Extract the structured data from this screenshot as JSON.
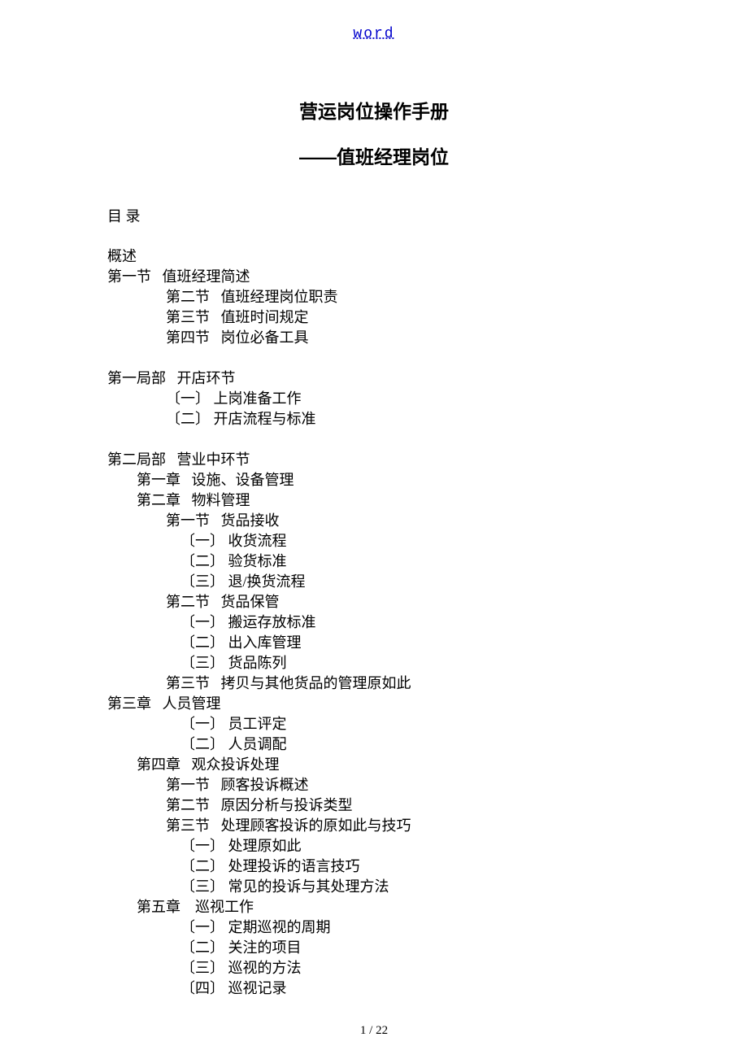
{
  "header_link": "word",
  "title": "营运岗位操作手册",
  "subtitle": "——值班经理岗位",
  "toc_heading": "目      录",
  "page_number": "1 / 22",
  "toc": [
    {
      "text": "概述",
      "indent": 0
    },
    {
      "text": "第一节   值班经理简述",
      "indent": 0
    },
    {
      "text": "第二节   值班经理岗位职责",
      "indent": 2
    },
    {
      "text": "第三节   值班时间规定",
      "indent": 2
    },
    {
      "text": "第四节   岗位必备工具",
      "indent": 2
    },
    {
      "spacer": true
    },
    {
      "text": "第一局部   开店环节",
      "indent": 0
    },
    {
      "text": "〔一〕 上岗准备工作",
      "indent": 2
    },
    {
      "text": "〔二〕 开店流程与标准",
      "indent": 2
    },
    {
      "spacer": true
    },
    {
      "text": "第二局部   营业中环节",
      "indent": 0
    },
    {
      "text": "第一章   设施、设备管理",
      "indent": 1
    },
    {
      "text": "第二章   物料管理",
      "indent": 1
    },
    {
      "text": "第一节   货品接收",
      "indent": 2
    },
    {
      "text": "〔一〕 收货流程",
      "indent": 3
    },
    {
      "text": "〔二〕 验货标准",
      "indent": 3
    },
    {
      "text": "〔三〕 退/换货流程",
      "indent": 3
    },
    {
      "text": "第二节   货品保管",
      "indent": 2
    },
    {
      "text": "〔一〕 搬运存放标准",
      "indent": 3
    },
    {
      "text": "〔二〕 出入库管理",
      "indent": 3
    },
    {
      "text": "〔三〕 货品陈列",
      "indent": 3
    },
    {
      "text": "第三节   拷贝与其他货品的管理原如此",
      "indent": 2
    },
    {
      "text": "第三章   人员管理",
      "indent": 0
    },
    {
      "text": "〔一〕 员工评定",
      "indent": 3
    },
    {
      "text": "〔二〕 人员调配",
      "indent": 3
    },
    {
      "text": "第四章   观众投诉处理",
      "indent": 1
    },
    {
      "text": "第一节   顾客投诉概述",
      "indent": 2
    },
    {
      "text": "第二节   原因分析与投诉类型",
      "indent": 2
    },
    {
      "text": "第三节   处理顾客投诉的原如此与技巧",
      "indent": 2
    },
    {
      "text": "〔一〕 处理原如此",
      "indent": 3
    },
    {
      "text": "〔二〕 处理投诉的语言技巧",
      "indent": 3
    },
    {
      "text": "〔三〕 常见的投诉与其处理方法",
      "indent": 3
    },
    {
      "text": "第五章    巡视工作",
      "indent": 1
    },
    {
      "text": "〔一〕 定期巡视的周期",
      "indent": 3
    },
    {
      "text": "〔二〕 关注的项目",
      "indent": 3
    },
    {
      "text": "〔三〕 巡视的方法",
      "indent": 3
    },
    {
      "text": "〔四〕 巡视记录",
      "indent": 3
    }
  ]
}
